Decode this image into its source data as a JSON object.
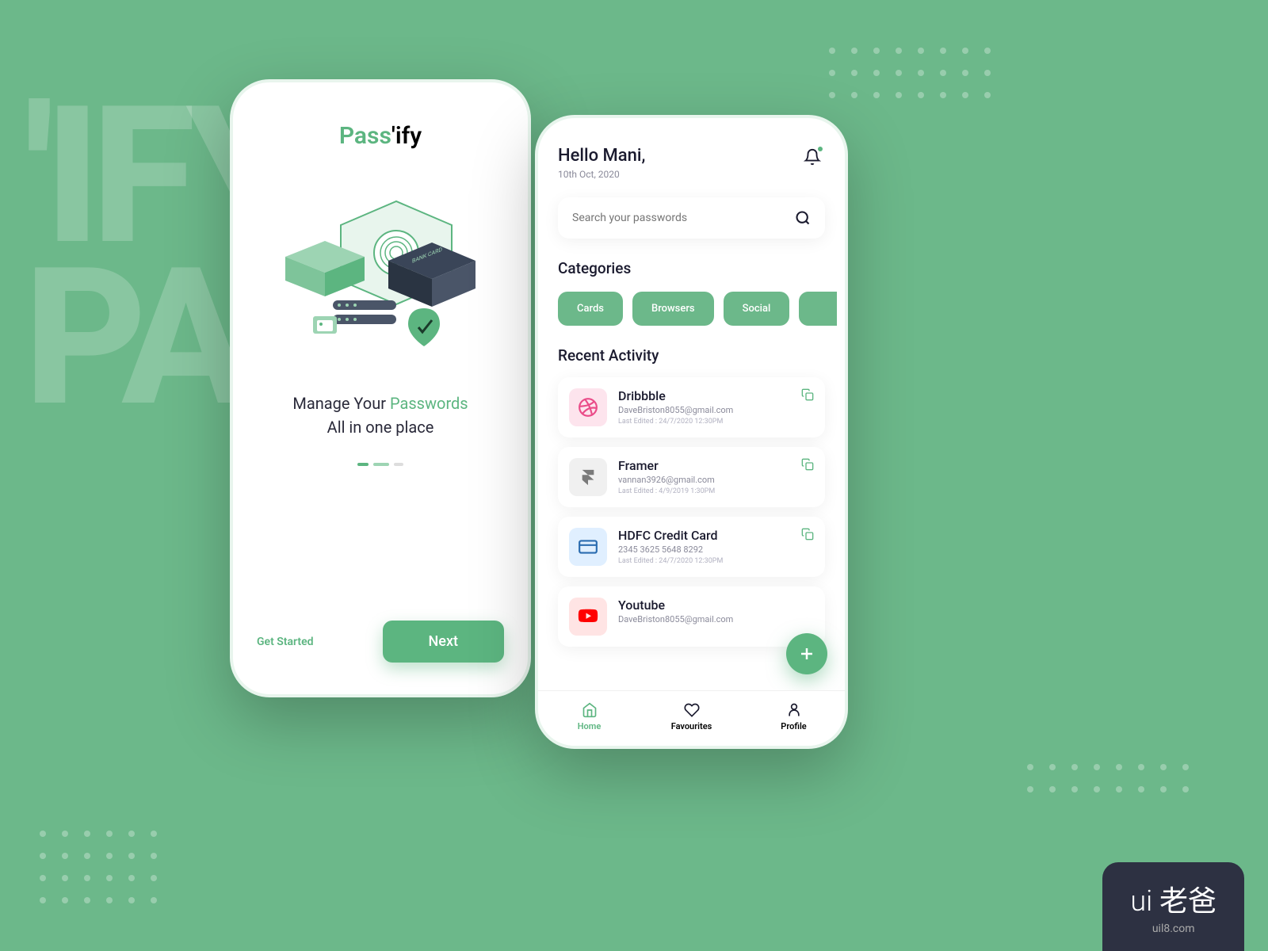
{
  "bg_text_line1": "'IFY",
  "bg_text_line2": "PASS",
  "onboarding": {
    "title_part1": "Pass",
    "title_part2": "'ify",
    "tagline_part1": "Manage Your ",
    "tagline_part2": "Passwords",
    "tagline_part3": "All in one place",
    "illustration_card_label": "BANK CARD",
    "get_started": "Get Started",
    "next_btn": "Next"
  },
  "home": {
    "greeting": "Hello Mani,",
    "date": "10th Oct, 2020",
    "search_placeholder": "Search your passwords",
    "categories_title": "Categories",
    "categories": [
      "Cards",
      "Browsers",
      "Social"
    ],
    "recent_title": "Recent Activity",
    "items": [
      {
        "title": "Dribbble",
        "sub": "DaveBriston8055@gmail.com",
        "meta": "Last Edited : 24/7/2020  12:30PM",
        "icon_bg": "#fde4ed",
        "icon_color": "#ea4c89"
      },
      {
        "title": "Framer",
        "sub": "vannan3926@gmail.com",
        "meta": "Last Edited : 4/9/2019  1:30PM",
        "icon_bg": "#f0f0f0",
        "icon_color": "#7a7a7a"
      },
      {
        "title": "HDFC Credit Card",
        "sub": "2345 3625 5648 8292",
        "meta": "Last Edited : 24/7/2020  12:30PM",
        "icon_bg": "#e0efff",
        "icon_color": "#2b6cb0"
      },
      {
        "title": "Youtube",
        "sub": "DaveBriston8055@gmail.com",
        "meta": "",
        "icon_bg": "#ffe4e4",
        "icon_color": "#ff0000"
      }
    ],
    "nav": {
      "home": "Home",
      "favourites": "Favourites",
      "profile": "Profile"
    }
  },
  "watermark": {
    "logo": "ui 老爸",
    "url": "uil8.com"
  }
}
